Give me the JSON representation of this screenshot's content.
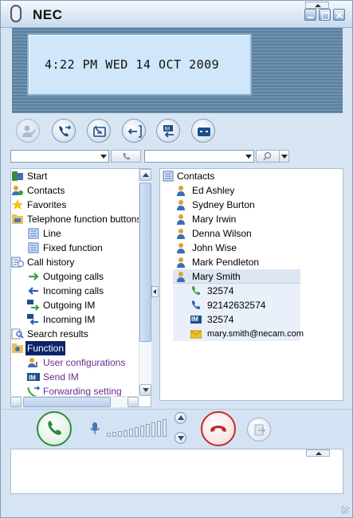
{
  "app": {
    "brand": "NEC"
  },
  "display": {
    "time": "4:22 PM",
    "weekday": "WED",
    "day": "14",
    "month": "OCT",
    "year": "2009"
  },
  "function_buttons": [
    {
      "icon": "check-user-icon"
    },
    {
      "icon": "call-forward-icon"
    },
    {
      "icon": "phone-book-icon"
    },
    {
      "icon": "call-back-icon"
    },
    {
      "icon": "im-transfer-icon"
    },
    {
      "icon": "voicemail-icon"
    }
  ],
  "selectors": {
    "left_value": "",
    "right_value": ""
  },
  "tree": {
    "items": [
      {
        "label": "Start",
        "icon": "start-icon"
      },
      {
        "label": "Contacts",
        "icon": "contacts-icon"
      },
      {
        "label": "Favorites",
        "icon": "star-icon"
      },
      {
        "label": "Telephone function buttons",
        "icon": "phone-folder-icon"
      },
      {
        "label": "Line",
        "icon": "list-icon"
      },
      {
        "label": "Fixed function",
        "icon": "list-icon"
      },
      {
        "label": "Call history",
        "icon": "history-icon"
      },
      {
        "label": "Outgoing calls",
        "icon": "outgoing-arrow-icon"
      },
      {
        "label": "Incoming calls",
        "icon": "incoming-arrow-icon"
      },
      {
        "label": "Outgoing IM",
        "icon": "outgoing-im-icon"
      },
      {
        "label": "Incoming IM",
        "icon": "incoming-im-icon"
      },
      {
        "label": "Search results",
        "icon": "search-icon"
      },
      {
        "label": "Function",
        "icon": "function-icon"
      },
      {
        "label": "User configurations",
        "icon": "user-config-icon"
      },
      {
        "label": "Send IM",
        "icon": "im-icon"
      },
      {
        "label": "Forwarding setting",
        "icon": "forward-icon"
      }
    ]
  },
  "contacts": {
    "header": "Contacts",
    "people": [
      "Ed Ashley",
      "Sydney Burton",
      "Mary Irwin",
      "Denna Wilson",
      "John Wise",
      "Mark Pendleton",
      "Mary Smith"
    ],
    "details": [
      {
        "type": "phone",
        "value": "32574"
      },
      {
        "type": "mobile",
        "value": "92142632574"
      },
      {
        "type": "im",
        "value": "32574",
        "badge": "IM"
      },
      {
        "type": "email",
        "value": "mary.smith@necam.com"
      }
    ]
  },
  "colors": {
    "answer": "#2f8a3b",
    "hangup": "#c52b2b",
    "selection": "#0a246a",
    "function_link": "#6b2c8c"
  },
  "volume": {
    "level": 0
  }
}
